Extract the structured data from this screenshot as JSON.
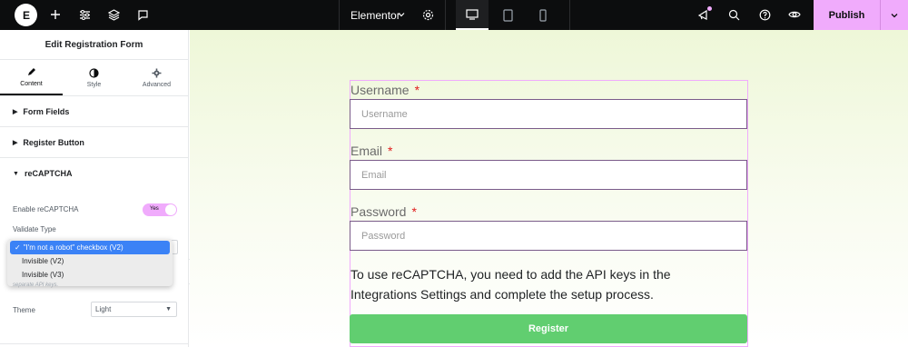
{
  "topbar": {
    "logo_text": "E",
    "site_name": "Elementor",
    "publish_label": "Publish",
    "accent_color": "#f0abfc"
  },
  "panel": {
    "title": "Edit Registration Form",
    "tabs": [
      {
        "label": "Content",
        "icon": "pencil-icon",
        "active": true
      },
      {
        "label": "Style",
        "icon": "half-circle-icon",
        "active": false
      },
      {
        "label": "Advanced",
        "icon": "gear-icon",
        "active": false
      }
    ],
    "sections": [
      {
        "label": "Form Fields"
      },
      {
        "label": "Register Button"
      },
      {
        "label": "reCAPTCHA"
      }
    ],
    "recaptcha": {
      "enable_label": "Enable reCAPTCHA",
      "toggle_value": "Yes",
      "validate_label": "Validate Type",
      "options": [
        "\"I'm not a robot\" checkbox (V2)",
        "Invisible (V2)",
        "Invisible (V3)"
      ],
      "selected_option": "\"I'm not a robot\" checkbox (V2)",
      "hint": "separate API keys.",
      "theme_label": "Theme",
      "theme_value": "Light"
    }
  },
  "form": {
    "fields": [
      {
        "label": "Username",
        "required_mark": "*",
        "placeholder": "Username"
      },
      {
        "label": "Email",
        "required_mark": "*",
        "placeholder": "Email"
      },
      {
        "label": "Password",
        "required_mark": "*",
        "placeholder": "Password"
      }
    ],
    "notice": "To use reCAPTCHA, you need to add the API keys in the Integrations Settings and complete the setup process.",
    "button_label": "Register",
    "button_color": "#61ce70"
  }
}
